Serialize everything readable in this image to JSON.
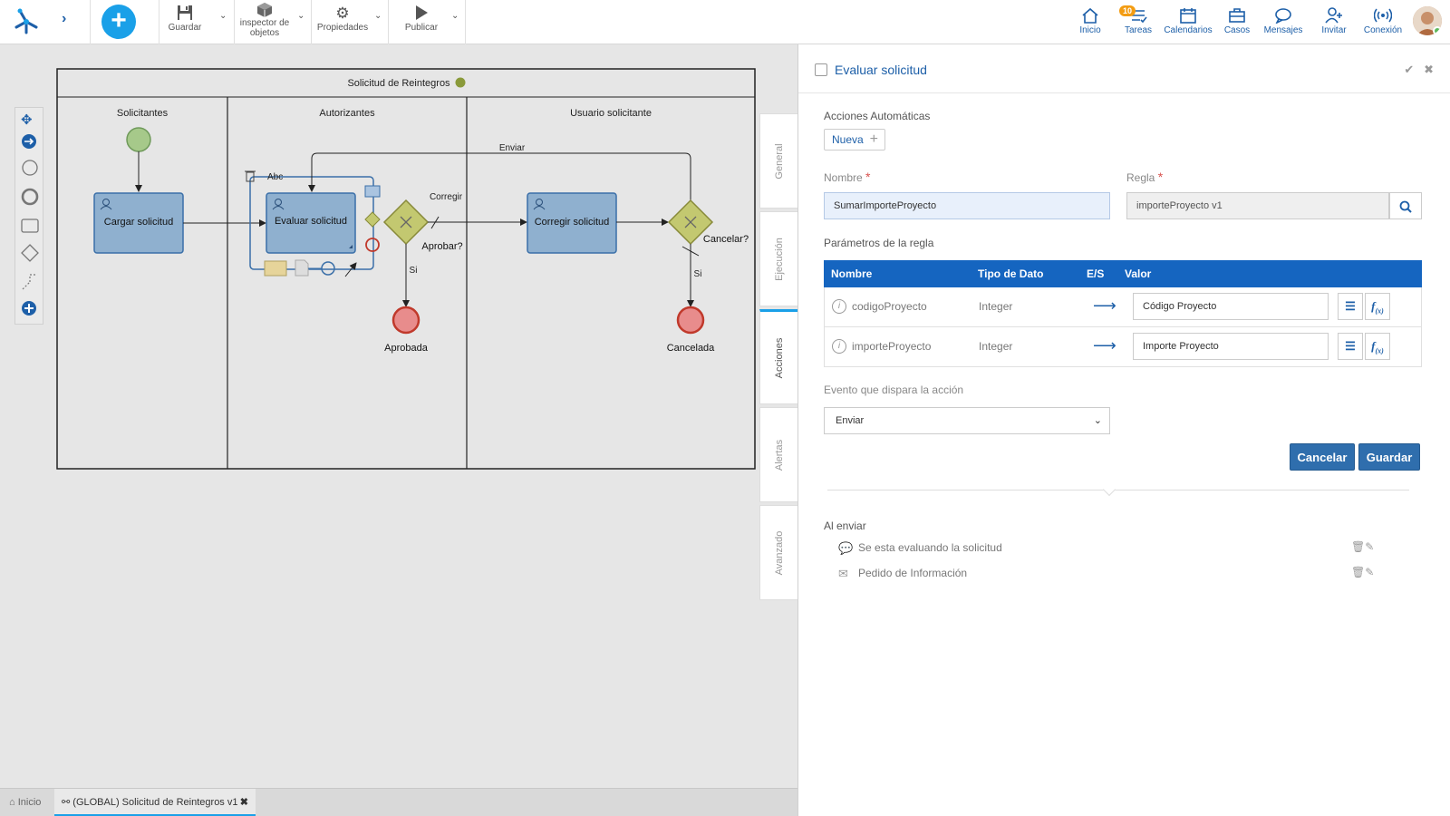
{
  "toolbar": {
    "save_label": "Guardar",
    "inspector_label_1": "inspector de",
    "inspector_label_2": "objetos",
    "properties_label": "Propiedades",
    "publish_label": "Publicar"
  },
  "nav": {
    "home": "Inicio",
    "tasks": "Tareas",
    "tasks_badge": "10",
    "calendars": "Calendarios",
    "cases": "Casos",
    "messages": "Mensajes",
    "invite": "Invitar",
    "connection": "Conexión"
  },
  "diagram": {
    "pool_title": "Solicitud de Reintegros",
    "lanes": [
      "Solicitantes",
      "Autorizantes",
      "Usuario solicitante"
    ],
    "tasks": [
      "Cargar solicitud",
      "Evaluar solicitud",
      "Corregir solicitud"
    ],
    "gateways": [
      "Aprobar?",
      "Cancelar?"
    ],
    "flows": [
      "Enviar",
      "Corregir",
      "Si",
      "Si"
    ],
    "end_events": [
      "Aprobada",
      "Cancelada"
    ],
    "edit_text": "Abc"
  },
  "side_tabs": [
    "General",
    "Ejecución",
    "Acciones",
    "Alertas",
    "Avanzado"
  ],
  "bottom_tabs": {
    "home": "Inicio",
    "process": "(GLOBAL) Solicitud de Reintegros v1"
  },
  "panel": {
    "title": "Evaluar solicitud",
    "auto_actions_label": "Acciones Automáticas",
    "new_button": "Nueva",
    "name_label": "Nombre",
    "name_value": "SumarImporteProyecto",
    "rule_label": "Regla",
    "rule_value": "importeProyecto v1",
    "params_label": "Parámetros de la regla",
    "table_headers": [
      "Nombre",
      "Tipo de Dato",
      "E/S",
      "Valor"
    ],
    "params": [
      {
        "name": "codigoProyecto",
        "type": "Integer",
        "value": "Código Proyecto"
      },
      {
        "name": "importeProyecto",
        "type": "Integer",
        "value": "Importe Proyecto"
      }
    ],
    "event_label": "Evento que dispara la acción",
    "event_value": "Enviar",
    "cancel_button": "Cancelar",
    "save_button": "Guardar",
    "on_send_label": "Al enviar",
    "on_send_items": [
      "Se esta evaluando la solicitud",
      "Pedido de Información"
    ]
  },
  "colors": {
    "accent": "#1aa0e8",
    "brand_blue": "#1565c0",
    "task_fill": "#8fb0cf",
    "gateway_fill": "#c3c870",
    "end_event": "#d9534f",
    "start_event": "#a6c98a"
  }
}
